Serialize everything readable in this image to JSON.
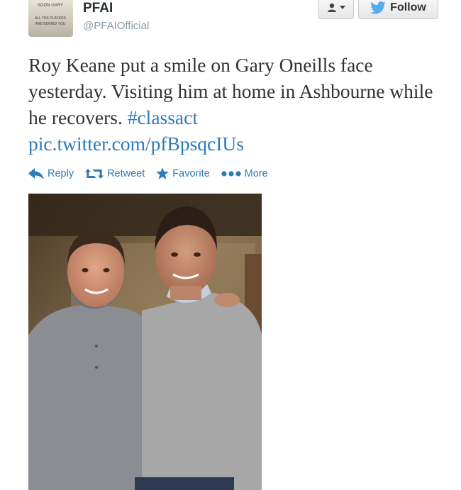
{
  "author": {
    "name": "PFAI",
    "handle": "@PFAIOfficial",
    "avatar_text": [
      "SOON GARY",
      "ALL THE PLAYERS",
      "ARE BEHIND YOU"
    ]
  },
  "buttons": {
    "user_icon": "user-dropdown-icon",
    "follow_label": "Follow"
  },
  "tweet": {
    "text": "Roy Keane put a smile on Gary Oneills face yesterday. Visiting him at home in Ashbourne while he recovers.",
    "hashtag": "#classact",
    "pic_link": "pic.twitter.com/pfBpsqcIUs"
  },
  "actions": {
    "reply": "Reply",
    "retweet": "Retweet",
    "favorite": "Favorite",
    "more": "More"
  },
  "colors": {
    "link": "#2b7bb9",
    "twitter_bird": "#55acee"
  }
}
